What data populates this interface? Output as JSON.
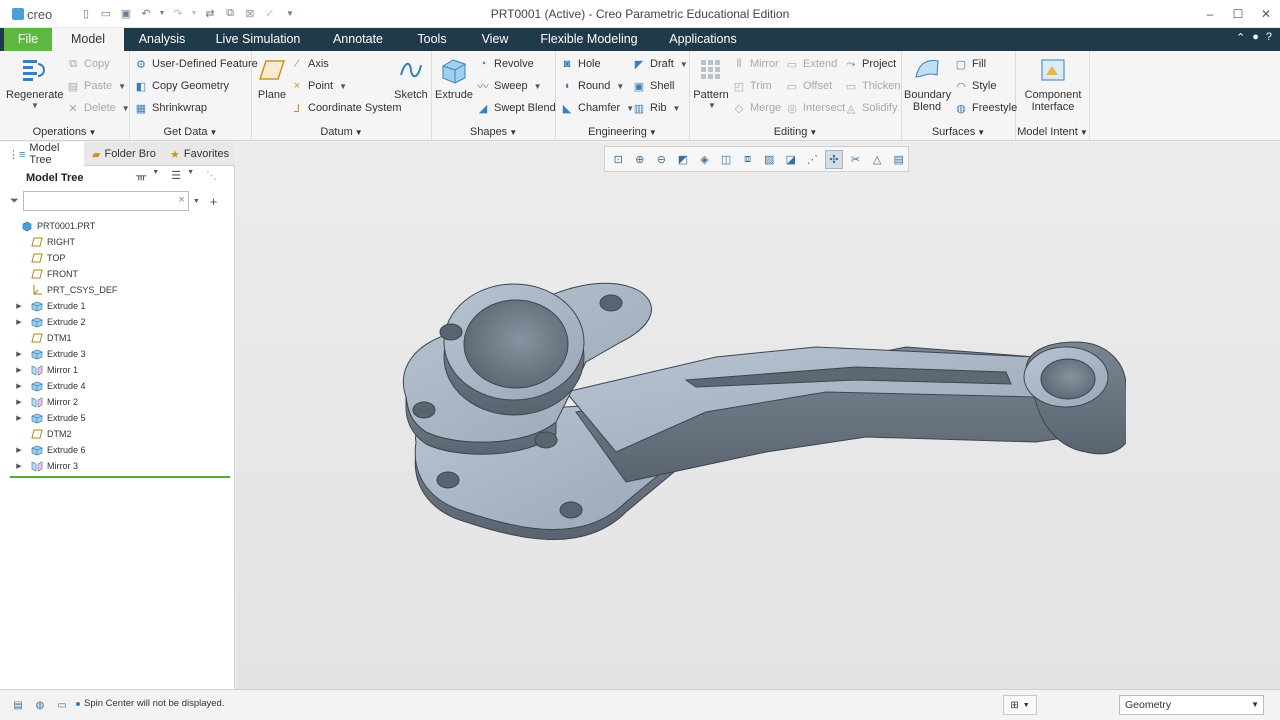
{
  "window": {
    "title": "PRT0001 (Active) - Creo Parametric Educational Edition",
    "logo_text": "creo"
  },
  "tabs": [
    "File",
    "Model",
    "Analysis",
    "Live Simulation",
    "Annotate",
    "Tools",
    "View",
    "Flexible Modeling",
    "Applications"
  ],
  "active_tab": "Model",
  "ribbon": {
    "operations": {
      "label": "Operations",
      "regenerate": "Regenerate",
      "copy": "Copy",
      "paste": "Paste",
      "delete": "Delete"
    },
    "get_data": {
      "label": "Get Data",
      "udf": "User-Defined Feature",
      "copy_geometry": "Copy Geometry",
      "shrinkwrap": "Shrinkwrap"
    },
    "datum": {
      "label": "Datum",
      "plane": "Plane",
      "axis": "Axis",
      "point": "Point",
      "csys": "Coordinate System",
      "sketch": "Sketch"
    },
    "shapes": {
      "label": "Shapes",
      "extrude": "Extrude",
      "revolve": "Revolve",
      "sweep": "Sweep",
      "swept_blend": "Swept Blend"
    },
    "engineering": {
      "label": "Engineering",
      "hole": "Hole",
      "round": "Round",
      "chamfer": "Chamfer",
      "draft": "Draft",
      "shell": "Shell",
      "rib": "Rib"
    },
    "editing": {
      "label": "Editing",
      "pattern": "Pattern",
      "mirror": "Mirror",
      "trim": "Trim",
      "merge": "Merge",
      "extend": "Extend",
      "offset": "Offset",
      "intersect": "Intersect",
      "project": "Project",
      "thicken": "Thicken",
      "solidify": "Solidify"
    },
    "surfaces": {
      "label": "Surfaces",
      "boundary_blend_1": "Boundary",
      "boundary_blend_2": "Blend",
      "fill": "Fill",
      "style": "Style",
      "freestyle": "Freestyle"
    },
    "model_intent": {
      "label": "Model Intent",
      "component_interface_1": "Component",
      "component_interface_2": "Interface"
    }
  },
  "left_panel": {
    "nav_tabs": [
      "Model Tree",
      "Folder Bro",
      "Favorites"
    ],
    "tree_header": "Model Tree",
    "search_value": "",
    "tree": [
      {
        "label": "PRT0001.PRT",
        "type": "part",
        "expandable": false,
        "indent": 0
      },
      {
        "label": "RIGHT",
        "type": "plane",
        "expandable": false,
        "indent": 1
      },
      {
        "label": "TOP",
        "type": "plane",
        "expandable": false,
        "indent": 1
      },
      {
        "label": "FRONT",
        "type": "plane",
        "expandable": false,
        "indent": 1
      },
      {
        "label": "PRT_CSYS_DEF",
        "type": "csys",
        "expandable": false,
        "indent": 1
      },
      {
        "label": "Extrude 1",
        "type": "extrude",
        "expandable": true,
        "indent": 1
      },
      {
        "label": "Extrude 2",
        "type": "extrude",
        "expandable": true,
        "indent": 1
      },
      {
        "label": "DTM1",
        "type": "plane",
        "expandable": false,
        "indent": 1
      },
      {
        "label": "Extrude 3",
        "type": "extrude",
        "expandable": true,
        "indent": 1
      },
      {
        "label": "Mirror 1",
        "type": "mirror",
        "expandable": true,
        "indent": 1
      },
      {
        "label": "Extrude 4",
        "type": "extrude",
        "expandable": true,
        "indent": 1
      },
      {
        "label": "Mirror 2",
        "type": "mirror",
        "expandable": true,
        "indent": 1
      },
      {
        "label": "Extrude 5",
        "type": "extrude",
        "expandable": true,
        "indent": 1
      },
      {
        "label": "DTM2",
        "type": "plane",
        "expandable": false,
        "indent": 1
      },
      {
        "label": "Extrude 6",
        "type": "extrude",
        "expandable": true,
        "indent": 1
      },
      {
        "label": "Mirror 3",
        "type": "mirror",
        "expandable": true,
        "indent": 1
      }
    ]
  },
  "status": {
    "message": "Spin Center will not be displayed.",
    "selection_filter": "Geometry"
  },
  "colors": {
    "tabbar": "#1f3a4a",
    "file_tab": "#5eb83f",
    "model_face": "#a9b6c4",
    "model_side": "#6a7582"
  }
}
